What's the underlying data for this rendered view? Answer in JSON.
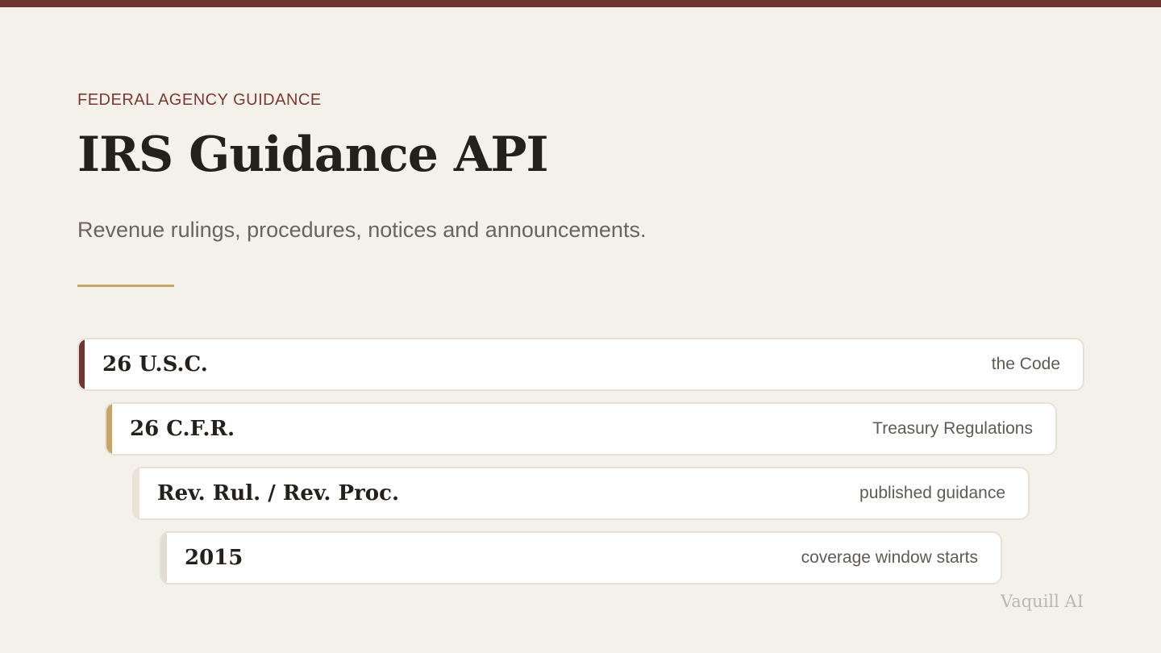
{
  "colors": {
    "top_bar": "#6f3530",
    "eyebrow": "#7a3a33",
    "rule": "#c9a46a"
  },
  "header": {
    "eyebrow": "FEDERAL AGENCY GUIDANCE",
    "title": "IRS Guidance API",
    "subtitle": "Revenue rulings, procedures, notices and announcements."
  },
  "layers": [
    {
      "name": "26 U.S.C.",
      "description": "the Code",
      "accent": "#6f3530"
    },
    {
      "name": "26 C.F.R.",
      "description": "Treasury Regulations",
      "accent": "#c9a46a"
    },
    {
      "name": "Rev. Rul. / Rev. Proc.",
      "description": "published guidance",
      "accent": "#e9e3d9"
    },
    {
      "name": "2015",
      "description": "coverage window starts",
      "accent": "#e2dbcf"
    }
  ],
  "footer": {
    "brand": "Vaquill AI"
  }
}
